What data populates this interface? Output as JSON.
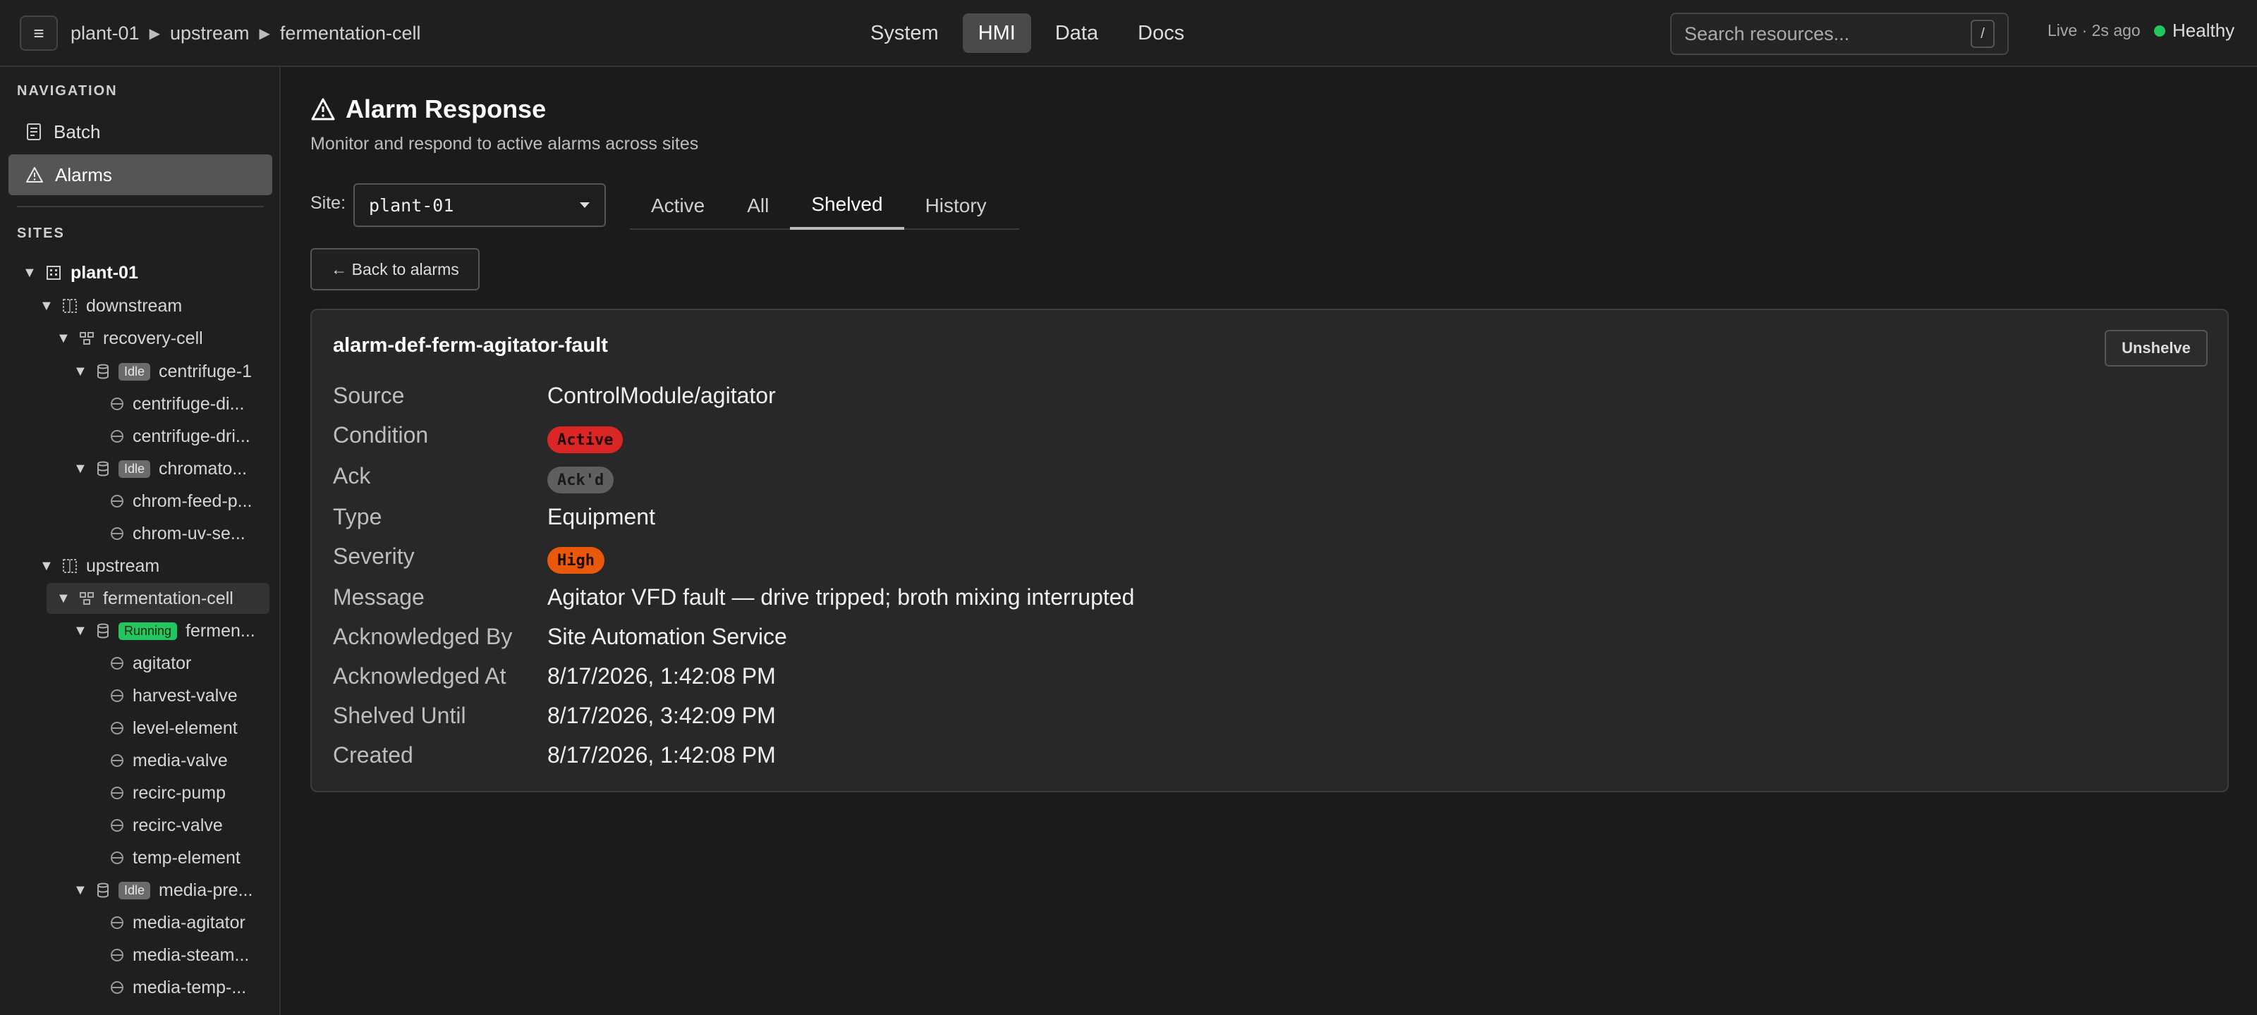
{
  "header": {
    "menu_icon": "hamburger-icon",
    "breadcrumbs": [
      "plant-01",
      "upstream",
      "fermentation-cell"
    ],
    "nav": [
      "System",
      "HMI",
      "Data",
      "Docs"
    ],
    "active_nav": "HMI",
    "search_placeholder": "Search resources...",
    "search_shortcut": "/",
    "live_status": "Live · 2s ago",
    "health": "Healthy",
    "health_color": "#22c55e"
  },
  "sidebar": {
    "navigation_title": "NAVIGATION",
    "nav_items": [
      {
        "label": "Batch",
        "icon": "document-icon"
      },
      {
        "label": "Alarms",
        "icon": "warning-icon"
      }
    ],
    "sites_title": "SITES",
    "tree": [
      {
        "label": "plant-01"
      },
      {
        "label": "downstream"
      },
      {
        "label": "recovery-cell"
      },
      {
        "label": "centrifuge-1",
        "badge": "Idle"
      },
      {
        "label": "centrifuge-di..."
      },
      {
        "label": "centrifuge-dri..."
      },
      {
        "label": "chromato...",
        "badge": "Idle"
      },
      {
        "label": "chrom-feed-p..."
      },
      {
        "label": "chrom-uv-se..."
      },
      {
        "label": "upstream"
      },
      {
        "label": "fermentation-cell"
      },
      {
        "label": "fermen...",
        "badge": "Running"
      },
      {
        "label": "agitator"
      },
      {
        "label": "harvest-valve"
      },
      {
        "label": "level-element"
      },
      {
        "label": "media-valve"
      },
      {
        "label": "recirc-pump"
      },
      {
        "label": "recirc-valve"
      },
      {
        "label": "temp-element"
      },
      {
        "label": "media-pre...",
        "badge": "Idle"
      },
      {
        "label": "media-agitator"
      },
      {
        "label": "media-steam..."
      },
      {
        "label": "media-temp-..."
      }
    ]
  },
  "main": {
    "title": "Alarm Response",
    "subtitle": "Monitor and respond to active alarms across sites",
    "site_label": "Site:",
    "site_value": "plant-01",
    "tabs": [
      "Active",
      "All",
      "Shelved",
      "History"
    ],
    "active_tab": "Shelved",
    "back_label": "← Back to alarms"
  },
  "alarm": {
    "id": "alarm-def-ferm-agitator-fault",
    "unshelve_label": "Unshelve",
    "labels": {
      "source": "Source",
      "condition": "Condition",
      "ack": "Ack",
      "type": "Type",
      "severity": "Severity",
      "message": "Message",
      "ack_by": "Acknowledged By",
      "ack_at": "Acknowledged At",
      "shelved_until": "Shelved Until",
      "created": "Created"
    },
    "source": "ControlModule/agitator",
    "condition": "Active",
    "condition_color": "#dc2626",
    "ack": "Ack'd",
    "ack_color": "#5f5f5f",
    "type": "Equipment",
    "severity": "High",
    "severity_color": "#ea580c",
    "message": "Agitator VFD fault — drive tripped; broth mixing interrupted",
    "ack_by": "Site Automation Service",
    "ack_at": "8/17/2026, 1:42:08 PM",
    "shelved_until": "8/17/2026, 3:42:09 PM",
    "created": "8/17/2026, 1:42:08 PM"
  }
}
